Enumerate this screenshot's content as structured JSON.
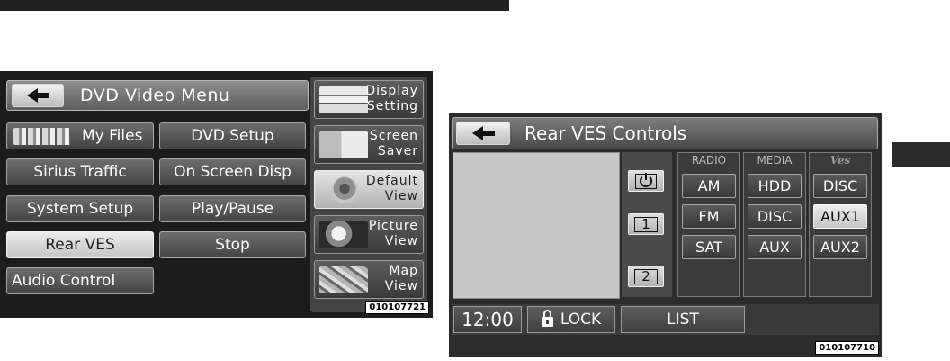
{
  "dvd_menu": {
    "title": "DVD Video Menu",
    "buttons": [
      {
        "label": "My Files"
      },
      {
        "label": "DVD Setup"
      },
      {
        "label": "Sirius Traffic"
      },
      {
        "label": "On Screen Disp"
      },
      {
        "label": "System Setup"
      },
      {
        "label": "Play/Pause"
      },
      {
        "label": "Rear VES",
        "selected": true
      },
      {
        "label": "Stop"
      },
      {
        "label": "Audio Control"
      }
    ],
    "side_buttons": [
      {
        "label_line1": "Display",
        "label_line2": "Setting",
        "icon": "display-setting-icon"
      },
      {
        "label_line1": "Screen",
        "label_line2": "Saver",
        "icon": "screen-saver-icon"
      },
      {
        "label_line1": "Default",
        "label_line2": "View",
        "icon": "default-view-icon",
        "selected": true
      },
      {
        "label_line1": "Picture",
        "label_line2": "View",
        "icon": "picture-view-icon"
      },
      {
        "label_line1": "Map",
        "label_line2": "View",
        "icon": "map-view-icon"
      }
    ],
    "image_code": "010107721"
  },
  "ves_controls": {
    "title": "Rear VES Controls",
    "zones": [
      {
        "label": "",
        "icon": "power-icon"
      },
      {
        "label": "1",
        "selected": true
      },
      {
        "label": "2"
      }
    ],
    "columns": [
      {
        "header": "RADIO",
        "buttons": [
          "AM",
          "FM",
          "SAT"
        ]
      },
      {
        "header": "MEDIA",
        "buttons": [
          "HDD",
          "DISC",
          "AUX"
        ]
      },
      {
        "header": "Ves",
        "buttons": [
          "DISC",
          "AUX1",
          "AUX2"
        ],
        "selected": "AUX1"
      }
    ],
    "bottom_bar": {
      "clock": "12:00",
      "lock_label": "LOCK",
      "list_label": "LIST"
    },
    "image_code": "010107710"
  },
  "colors": {
    "panel_bg": "#1c1c1c",
    "button_bg": "#555555",
    "selected_bg": "#dcdcdc",
    "text": "#ffffff"
  }
}
